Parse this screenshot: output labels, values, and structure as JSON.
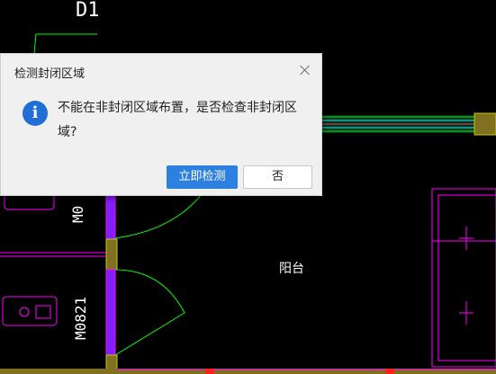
{
  "drawing": {
    "top_label": "D1",
    "door_labels": [
      "M0",
      "M0821"
    ],
    "room_label": "阳台",
    "colors": {
      "background": "#000000",
      "wall_line": "#ff00ff",
      "door_arc": "#00ff00",
      "wall_fill_yellow": "#c8a000",
      "purple_wall": "#a040ff"
    }
  },
  "dialog": {
    "title": "检测封闭区域",
    "close_icon": "close-icon",
    "info_icon": "info-icon",
    "info_glyph": "i",
    "message": "不能在非封闭区域布置，是否检查非封闭区域?",
    "primary_button": "立即检测",
    "secondary_button": "否"
  }
}
